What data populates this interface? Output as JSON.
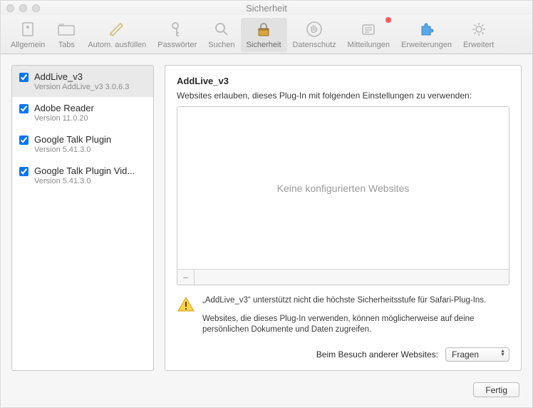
{
  "window": {
    "title": "Sicherheit"
  },
  "toolbar": {
    "items": [
      {
        "key": "allgemein",
        "label": "Allgemein",
        "icon": "general"
      },
      {
        "key": "tabs",
        "label": "Tabs",
        "icon": "tabs"
      },
      {
        "key": "autofill",
        "label": "Autom. ausfüllen",
        "icon": "autofill"
      },
      {
        "key": "passwords",
        "label": "Passwörter",
        "icon": "key"
      },
      {
        "key": "search",
        "label": "Suchen",
        "icon": "search"
      },
      {
        "key": "security",
        "label": "Sicherheit",
        "icon": "lock",
        "active": true
      },
      {
        "key": "privacy",
        "label": "Datenschutz",
        "icon": "hand"
      },
      {
        "key": "notif",
        "label": "Mitteilungen",
        "icon": "notif",
        "badge": true
      },
      {
        "key": "ext",
        "label": "Erweiterungen",
        "icon": "puzzle"
      },
      {
        "key": "advanced",
        "label": "Erweitert",
        "icon": "gear"
      }
    ]
  },
  "sidebar": {
    "plugins": [
      {
        "name": "AddLive_v3",
        "version": "Version AddLive_v3 3.0.6.3",
        "checked": true,
        "selected": true
      },
      {
        "name": "Adobe Reader",
        "version": "Version 11.0.20",
        "checked": true
      },
      {
        "name": "Google Talk Plugin",
        "version": "Version 5.41.3.0",
        "checked": true
      },
      {
        "name": "Google Talk Plugin Vid...",
        "version": "Version 5.41.3.0",
        "checked": true
      }
    ]
  },
  "detail": {
    "title": "AddLive_v3",
    "subtitle": "Websites erlauben, dieses Plug-In mit folgenden Einstellungen zu verwenden:",
    "empty_text": "Keine konfigurierten Websites",
    "warning_line1": "„AddLive_v3“ unterstützt nicht die höchste Sicherheitsstufe für Safari-Plug-Ins.",
    "warning_line2": "Websites, die dieses Plug-In verwenden, können möglicherweise auf deine persönlichen Dokumente und Daten zugreifen.",
    "other_sites_label": "Beim Besuch anderer Websites:",
    "other_sites_value": "Fragen"
  },
  "footer": {
    "done": "Fertig"
  }
}
